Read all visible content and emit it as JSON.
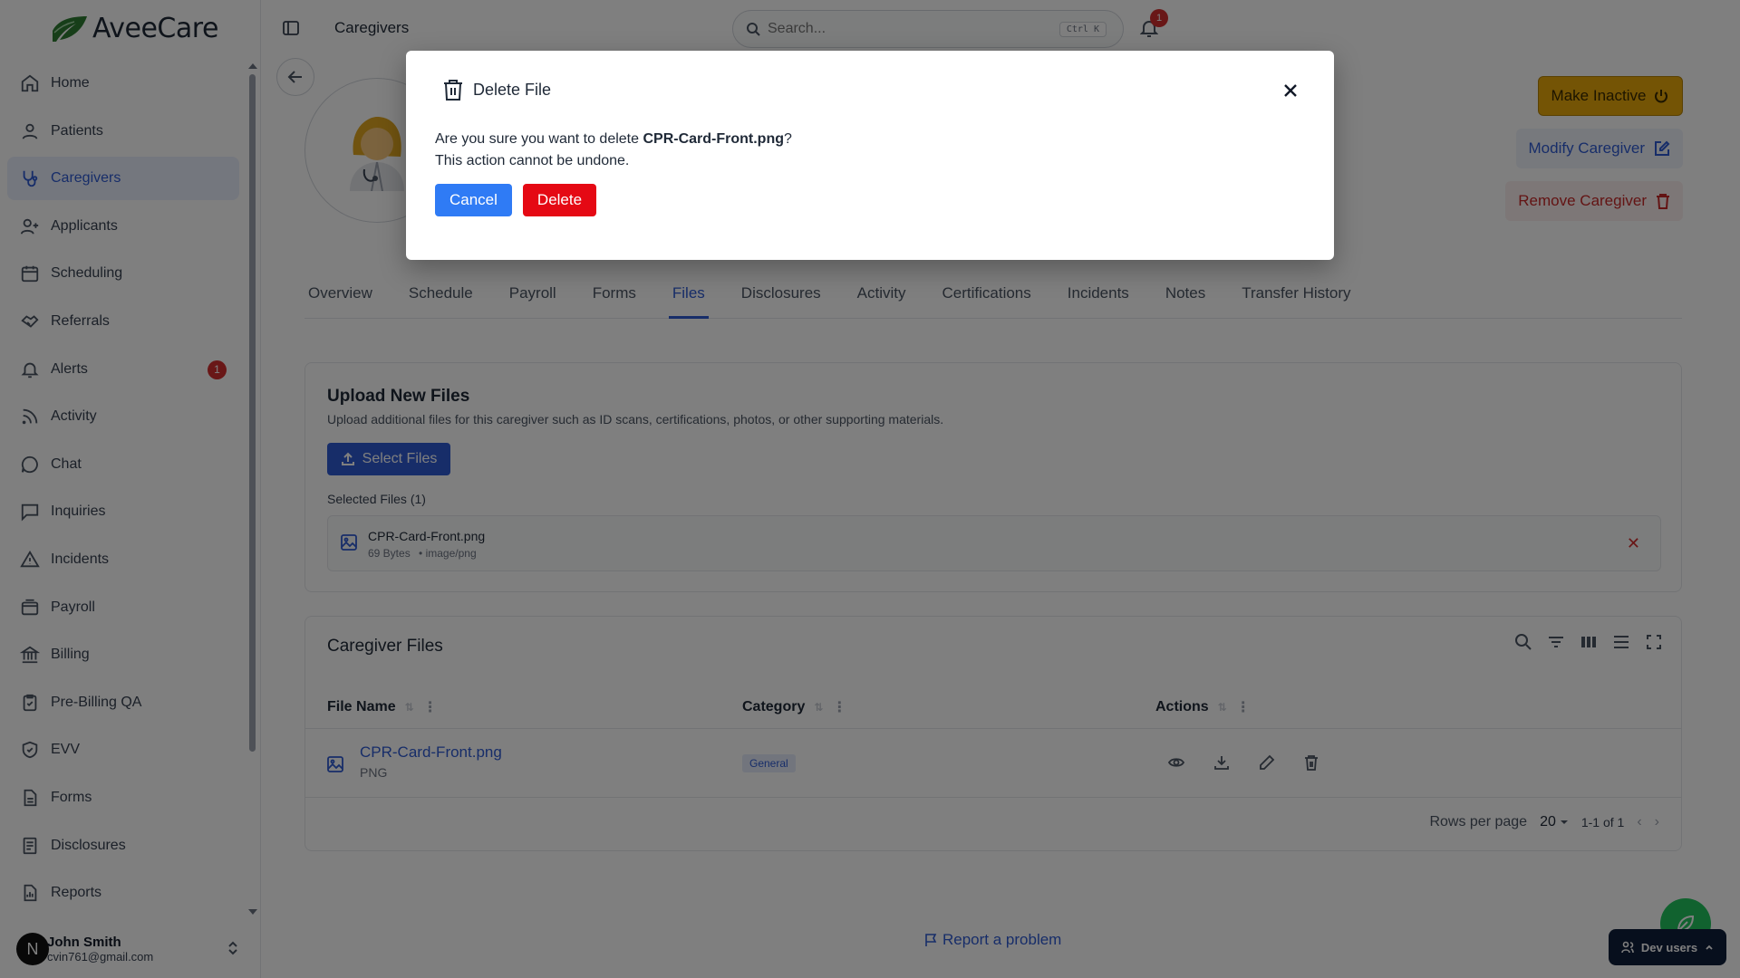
{
  "brand": {
    "name": "AveeCare",
    "accent": "#2f5bd3",
    "leaf_color": "#2e7d32"
  },
  "sidebar": {
    "items": [
      {
        "label": "Home",
        "icon": "home-icon"
      },
      {
        "label": "Patients",
        "icon": "user-icon"
      },
      {
        "label": "Caregivers",
        "icon": "stethoscope-icon",
        "active": true
      },
      {
        "label": "Applicants",
        "icon": "user-plus-icon"
      },
      {
        "label": "Scheduling",
        "icon": "calendar-icon"
      },
      {
        "label": "Referrals",
        "icon": "handshake-icon"
      },
      {
        "label": "Alerts",
        "icon": "bell-icon",
        "badge": "1"
      },
      {
        "label": "Activity",
        "icon": "rss-icon"
      },
      {
        "label": "Chat",
        "icon": "chat-bubble-icon"
      },
      {
        "label": "Inquiries",
        "icon": "message-square-icon"
      },
      {
        "label": "Incidents",
        "icon": "warning-triangle-icon"
      },
      {
        "label": "Payroll",
        "icon": "wallet-icon"
      },
      {
        "label": "Billing",
        "icon": "bank-icon"
      },
      {
        "label": "Pre-Billing QA",
        "icon": "clipboard-check-icon"
      },
      {
        "label": "EVV",
        "icon": "shield-check-icon"
      },
      {
        "label": "Forms",
        "icon": "document-icon"
      },
      {
        "label": "Disclosures",
        "icon": "file-text-icon"
      },
      {
        "label": "Reports",
        "icon": "report-icon"
      }
    ],
    "user": {
      "initial": "N",
      "name": "John Smith",
      "email": "cvin761@gmail.com"
    }
  },
  "topbar": {
    "title": "Caregivers",
    "search_placeholder": "Search...",
    "shortcut": "Ctrl K",
    "notification_count": "1"
  },
  "actions": {
    "make_inactive": "Make Inactive",
    "modify": "Modify Caregiver",
    "remove": "Remove Caregiver"
  },
  "tabs": [
    {
      "label": "Overview"
    },
    {
      "label": "Schedule"
    },
    {
      "label": "Payroll"
    },
    {
      "label": "Forms"
    },
    {
      "label": "Files",
      "active": true
    },
    {
      "label": "Disclosures"
    },
    {
      "label": "Activity"
    },
    {
      "label": "Certifications"
    },
    {
      "label": "Incidents"
    },
    {
      "label": "Notes"
    },
    {
      "label": "Transfer History"
    }
  ],
  "upload": {
    "title": "Upload New Files",
    "description": "Upload additional files for this caregiver such as ID scans, certifications, photos, or other supporting materials.",
    "select_label": "Select Files",
    "selected_label": "Selected Files (1)",
    "selected_file": {
      "name": "CPR-Card-Front.png",
      "size": "69 Bytes",
      "mime": "• image/png"
    }
  },
  "files_table": {
    "title": "Caregiver Files",
    "columns": [
      "File Name",
      "Category",
      "Actions"
    ],
    "rows": [
      {
        "name": "CPR-Card-Front.png",
        "type": "PNG",
        "category": "General"
      }
    ],
    "rows_per_page_label": "Rows per page",
    "rows_per_page": "20",
    "range": "1-1 of 1"
  },
  "footer": {
    "report": "Report a problem",
    "dev_users": "Dev users"
  },
  "modal": {
    "title": "Delete File",
    "message_prefix": "Are you sure you want to delete ",
    "file_name": "CPR-Card-Front.png",
    "message_suffix": "?",
    "warning": "This action cannot be undone.",
    "cancel": "Cancel",
    "delete": "Delete"
  }
}
